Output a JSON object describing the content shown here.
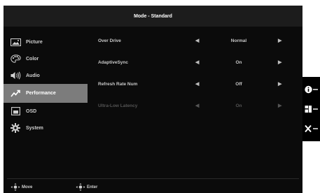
{
  "header": {
    "title": "Mode - Standard"
  },
  "sidebar": {
    "items": [
      {
        "label": "Picture",
        "icon": "picture-icon"
      },
      {
        "label": "Color",
        "icon": "palette-icon"
      },
      {
        "label": "Audio",
        "icon": "speaker-icon"
      },
      {
        "label": "Performance",
        "icon": "performance-icon",
        "active": true
      },
      {
        "label": "OSD",
        "icon": "osd-icon"
      },
      {
        "label": "System",
        "icon": "gear-icon"
      }
    ]
  },
  "settings": {
    "rows": [
      {
        "label": "Over Drive",
        "value": "Normal",
        "enabled": true
      },
      {
        "label": "AdaptiveSync",
        "value": "On",
        "enabled": true
      },
      {
        "label": "Refresh Rate Num",
        "value": "Off",
        "enabled": true
      },
      {
        "label": "Ultra-Low Latency",
        "value": "On",
        "enabled": false
      }
    ]
  },
  "footer": {
    "move_label": "Move",
    "enter_label": "Enter"
  },
  "side_buttons": [
    {
      "icon": "info-icon"
    },
    {
      "icon": "input-source-icon"
    },
    {
      "icon": "close-icon"
    }
  ],
  "colors": {
    "active_item": "#7c7c7c",
    "title_bar": "#1c1c1c",
    "background": "#0b0b0b"
  }
}
